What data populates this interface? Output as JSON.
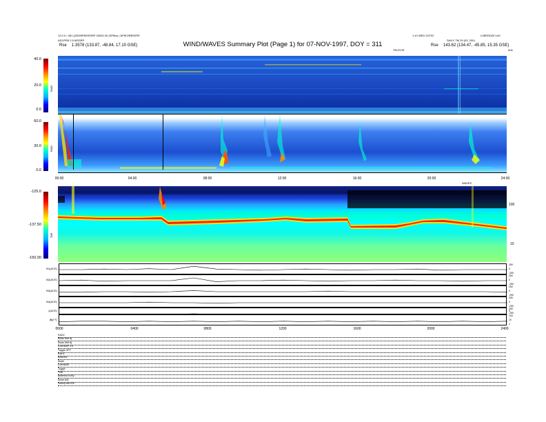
{
  "header": {
    "title": "WIND/WAVES Summary Plot (Page 1) for 07-NOV-1997, DOY = 311",
    "left_line1": "12.0.0 • 281 (20009PMSSSRP 20000 00 (SPMa) • APIEORBSSPE",
    "left_line2": "ASJ/FEB 2.5 MSSRP",
    "left_rse_label": "Rse",
    "left_rse_value": "1.3578 (133.87, -48.84, 17.10 GSE)",
    "right_line1": "1.10 WED 2UT02",
    "right_line2": "L2BRODAT.v.b0",
    "right_line3": "DAILY TM 29 (03, 200)",
    "right_rse_label": "Rse",
    "right_rse_value": "143.62 (134.47, -45.85, 15.35 GSE)",
    "right_units": "kHz"
  },
  "rad2": {
    "name": "RAD2",
    "ticks": [
      "40.0",
      "20.0",
      "0.0"
    ],
    "top_label": "TELEVIS"
  },
  "rad1": {
    "name": "RAD1",
    "ticks": [
      "60.0",
      "30.0",
      "0.0"
    ]
  },
  "tnr": {
    "name": "TNR",
    "ticks": [
      "-125.0",
      "-137.50",
      "-150.00"
    ],
    "right_ticks": [
      "100",
      "10"
    ],
    "top_label": "WAVES"
  },
  "time_axis": {
    "labels_upper": [
      "00:00",
      "04:00",
      "08:00",
      "12:00",
      "16:00",
      "20:00",
      "24:00"
    ],
    "labels_lower": [
      "0000",
      "0400",
      "0800",
      "1200",
      "1600",
      "2000",
      "2400"
    ]
  },
  "strips": [
    {
      "label": "B1(ACE)",
      "ticks": [
        "250",
        "0",
        "-250"
      ],
      "shape": [
        0.5,
        0.5,
        0.45,
        0.5,
        0.42,
        0.5,
        0.2,
        0.45,
        0.5,
        0.55,
        0.5,
        0.45,
        0.5,
        0.55,
        0.5,
        0.5,
        0.45,
        0.55,
        0.5,
        0.5,
        0.5
      ]
    },
    {
      "label": "B2(ACE)",
      "ticks": [
        "250",
        "0",
        "-250"
      ],
      "shape": [
        0.5,
        0.45,
        0.55,
        0.5,
        0.5,
        0.5,
        0.25,
        0.6,
        0.5,
        0.5,
        0.45,
        0.5,
        0.55,
        0.5,
        0.5,
        0.45,
        0.5,
        0.5,
        0.55,
        0.5,
        0.5
      ]
    },
    {
      "label": "B3(ACE)",
      "ticks": [
        "250",
        "0",
        "-250"
      ],
      "shape": [
        0.55,
        0.55,
        0.5,
        0.5,
        0.55,
        0.5,
        0.4,
        0.5,
        0.5,
        0.5,
        0.5,
        0.5,
        0.45,
        0.5,
        0.5,
        0.5,
        0.5,
        0.5,
        0.5,
        0.5,
        0.55
      ]
    },
    {
      "label": "B4(ACE)",
      "ticks": [
        "250",
        "0",
        "-250"
      ],
      "shape": [
        0.5,
        0.5,
        0.5,
        0.5,
        0.45,
        0.5,
        0.5,
        0.55,
        0.5,
        0.5,
        0.5,
        0.5,
        0.5,
        0.5,
        0.5,
        0.5,
        0.5,
        0.5,
        0.5,
        0.5,
        0.5
      ]
    },
    {
      "label": "λ(ACE)",
      "ticks": [
        "250",
        "0",
        "-250"
      ],
      "shape": [
        0.6,
        0.6,
        0.55,
        0.6,
        0.55,
        0.6,
        0.5,
        0.6,
        0.6,
        0.55,
        0.6,
        0.6,
        0.6,
        0.55,
        0.6,
        0.6,
        0.6,
        0.55,
        0.6,
        0.6,
        0.6
      ]
    },
    {
      "label": "|B|(ⁿT)",
      "ticks": [
        "100",
        "10",
        "1"
      ],
      "shape": [
        0.6,
        0.55,
        0.55,
        0.6,
        0.55,
        0.6,
        0.55,
        0.6,
        0.55,
        0.6,
        0.55,
        0.6,
        0.55,
        0.6,
        0.55,
        0.6,
        0.55,
        0.6,
        0.55,
        0.6,
        0.55
      ]
    }
  ],
  "bottom_table": [
    {
      "label": "RAD2"
    },
    {
      "label": "Mode   MM   Bj"
    },
    {
      "label": "Mode   MM Bj"
    },
    {
      "label": "3-MHDAP 3.5"
    },
    {
      "label": "Toggle   OFF"
    },
    {
      "label": "RAD1"
    },
    {
      "label": "Antenna"
    },
    {
      "label": "Mode"
    },
    {
      "label": "3-MHDAP"
    },
    {
      "label": "Toggle"
    },
    {
      "label": "TNR"
    },
    {
      "label": "Antenna   Ex/Ey"
    },
    {
      "label": "Mode   A/B"
    },
    {
      "label": "Sweep   ABCDE"
    }
  ],
  "chart_data": {
    "type": "heatmap",
    "title": "WIND/WAVES Summary Plot (Page 1) for 07-NOV-1997, DOY = 311",
    "x": [
      "00:00",
      "04:00",
      "08:00",
      "12:00",
      "16:00",
      "20:00",
      "24:00"
    ],
    "panels": [
      {
        "name": "RAD2",
        "colorbar_range": [
          0.0,
          40.0
        ],
        "ylabel": "RAD2"
      },
      {
        "name": "RAD1",
        "colorbar_range": [
          0.0,
          60.0
        ],
        "ylabel": "RAD1"
      },
      {
        "name": "TNR",
        "colorbar_range": [
          -150.0,
          -125.0
        ],
        "ylabel": "TNR"
      }
    ],
    "colors": {
      "low": "#00007a",
      "mid": "#00ffd0",
      "high": "#7a0000"
    }
  }
}
